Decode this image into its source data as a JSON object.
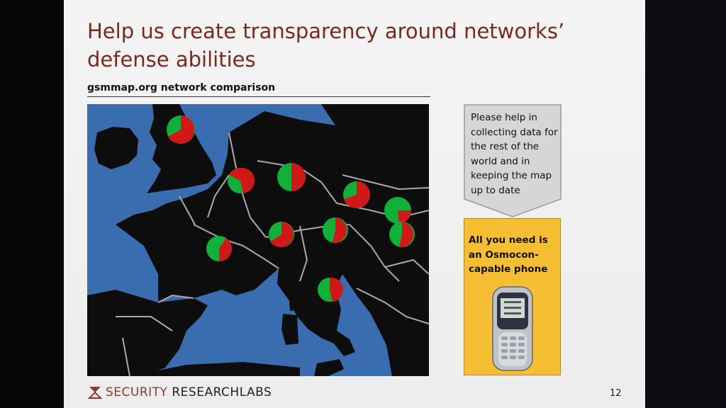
{
  "slide": {
    "title": "Help us create transparency around networks’ defense abilities",
    "subtitle": "gsmmap.org network comparison",
    "callout_text": "Please help in collecting data for the rest of the world and in keeping the map up to date",
    "yellow_text": "All you need is an Osmocon-capable phone",
    "logo_word1": "SECURITY",
    "logo_word2": "RESEARCHLABS",
    "page_number": "12"
  },
  "colors": {
    "title": "#7a2820",
    "sea": "#3a6db0",
    "land": "#0d0d0d",
    "pie_green": "#10b03a",
    "pie_red": "#d01818",
    "yellow_box": "#f6be33",
    "callout_grey": "#d6d6d6"
  },
  "map_pies": [
    {
      "country": "UK",
      "red_fraction": 0.68
    },
    {
      "country": "Belgium",
      "red_fraction": 0.55
    },
    {
      "country": "Germany",
      "red_fraction": 0.5
    },
    {
      "country": "Czech Republic",
      "red_fraction": 0.7
    },
    {
      "country": "Slovakia",
      "red_fraction": 0.3
    },
    {
      "country": "Hungary",
      "red_fraction": 0.6
    },
    {
      "country": "Switzerland",
      "red_fraction": 0.72
    },
    {
      "country": "Austria",
      "red_fraction": 0.6
    },
    {
      "country": "France",
      "red_fraction": 0.4
    },
    {
      "country": "Italy",
      "red_fraction": 0.55
    }
  ]
}
